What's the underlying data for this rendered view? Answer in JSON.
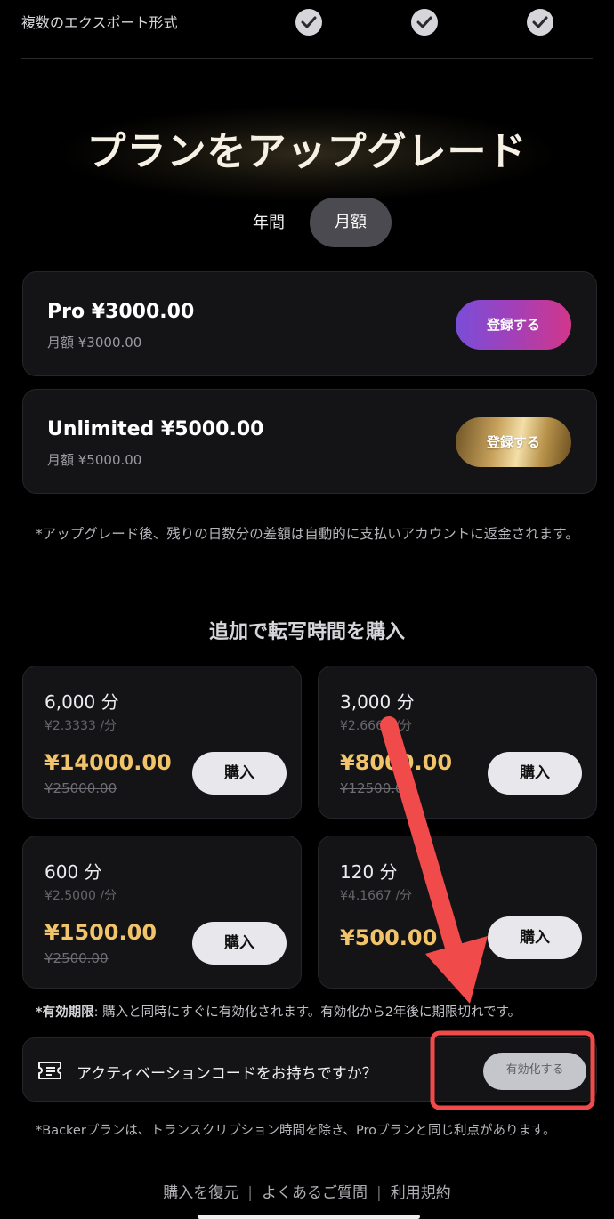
{
  "feature_row": {
    "label": "複数のエクスポート形式",
    "checks": [
      "check-icon",
      "check-icon",
      "check-icon"
    ]
  },
  "hero": {
    "title": "プランをアップグレード"
  },
  "billing_toggle": {
    "yearly": "年間",
    "monthly": "月額",
    "selected": "monthly"
  },
  "plans": [
    {
      "name": "Pro ¥3000.00",
      "sub": "月額 ¥3000.00",
      "button": "登録する"
    },
    {
      "name": "Unlimited ¥5000.00",
      "sub": "月額 ¥5000.00",
      "button": "登録する"
    }
  ],
  "upgrade_note": "*アップグレード後、残りの日数分の差額は自動的に支払いアカウントに返金されます。",
  "addon": {
    "title": "追加で転写時間を購入",
    "packs": [
      {
        "minutes": "6,000 分",
        "rate": "¥2.3333 /分",
        "price": "¥14000.00",
        "old_price": "¥25000.00",
        "button": "購入"
      },
      {
        "minutes": "3,000 分",
        "rate": "¥2.6667 /分",
        "price": "¥8000.00",
        "old_price": "¥12500.00",
        "button": "購入"
      },
      {
        "minutes": "600 分",
        "rate": "¥2.5000 /分",
        "price": "¥1500.00",
        "old_price": "¥2500.00",
        "button": "購入"
      },
      {
        "minutes": "120 分",
        "rate": "¥4.1667 /分",
        "price": "¥500.00",
        "old_price": "",
        "button": "購入"
      }
    ]
  },
  "validity": {
    "label": "*有効期限",
    "text": ": 購入と同時にすぐに有効化されます。有効化から2年後に期限切れです。"
  },
  "activation": {
    "icon": "ticket-icon",
    "text": "アクティベーションコードをお持ちですか？",
    "button": "有効化する"
  },
  "backer_note": "*Backerプランは、トランスクリプション時間を除き、Proプランと同じ利点があります。",
  "footer_links": [
    "購入を復元",
    "よくあるご質問",
    "利用規約"
  ],
  "colors": {
    "accent_gold": "#f2c46a",
    "annotation_red": "#f04a4a",
    "pro_gradient_start": "#7a4dd8",
    "pro_gradient_end": "#d2368a"
  }
}
